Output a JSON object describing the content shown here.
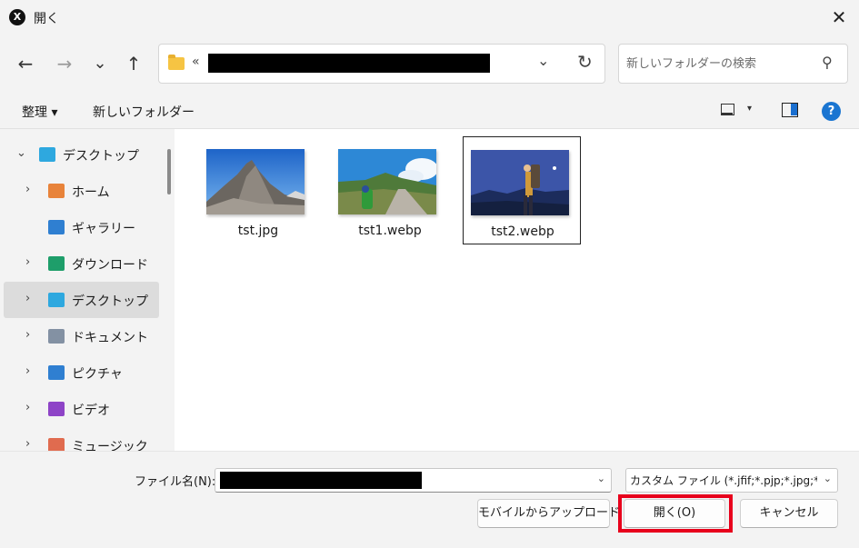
{
  "window": {
    "title": "開く",
    "app_icon_glyph": "X",
    "close_glyph": "✕"
  },
  "nav": {
    "back_glyph": "←",
    "forward_glyph": "→",
    "recent_glyph": "⌄",
    "up_glyph": "↑"
  },
  "address": {
    "separator": "«",
    "dropdown_glyph": "⌄",
    "refresh_glyph": "↻"
  },
  "search": {
    "placeholder": "新しいフォルダーの検索",
    "icon_glyph": "⚲"
  },
  "commands": {
    "organize": "整理 ▾",
    "new_folder": "新しいフォルダー",
    "view_chevron": "▾",
    "help_glyph": "?"
  },
  "sidebar": {
    "items": [
      {
        "label": "デスクトップ",
        "icon": "desktop-icon",
        "chevron": "⌄",
        "color": "#2ea8df"
      },
      {
        "label": "ホーム",
        "icon": "home-icon",
        "chevron": "›",
        "color": "#e8833a"
      },
      {
        "label": "ギャラリー",
        "icon": "gallery-icon",
        "chevron": "",
        "color": "#2f7fd1"
      },
      {
        "label": "ダウンロード",
        "icon": "download-icon",
        "chevron": "›",
        "color": "#1e9e6a"
      },
      {
        "label": "デスクトップ",
        "icon": "desktop-icon",
        "chevron": "›",
        "color": "#2ea8df"
      },
      {
        "label": "ドキュメント",
        "icon": "document-icon",
        "chevron": "›",
        "color": "#8391a3"
      },
      {
        "label": "ピクチャ",
        "icon": "pictures-icon",
        "chevron": "›",
        "color": "#2f7fd1"
      },
      {
        "label": "ビデオ",
        "icon": "video-icon",
        "chevron": "›",
        "color": "#8e44c7"
      },
      {
        "label": "ミュージック",
        "icon": "music-icon",
        "chevron": "›",
        "color": "#e06b4f"
      }
    ],
    "selected_index": 4
  },
  "files": [
    {
      "name": "tst.jpg"
    },
    {
      "name": "tst1.webp"
    },
    {
      "name": "tst2.webp"
    }
  ],
  "footer": {
    "filename_label": "ファイル名(N):",
    "dropdown_glyph": "⌄",
    "file_type": "カスタム ファイル (*.jfif;*.pjp;*.jpg;*.",
    "upload_button": "モバイルからアップロード",
    "open_button": "開く(O)",
    "cancel_button": "キャンセル"
  },
  "colors": {
    "highlight": "#e8001c",
    "accent": "#1a75d1"
  }
}
